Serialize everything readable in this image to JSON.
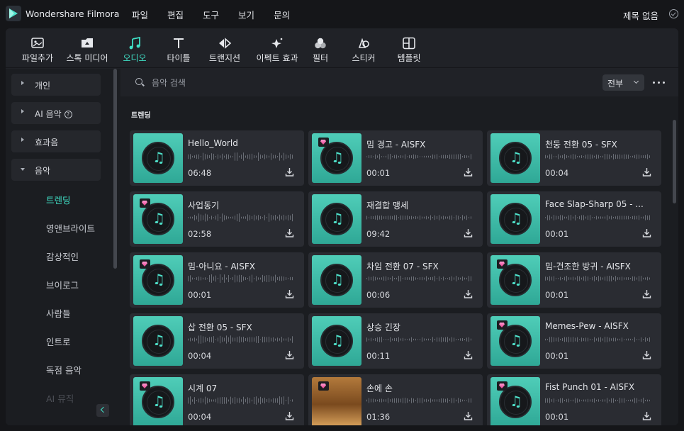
{
  "app": {
    "title": "Wondershare Filmora",
    "doc_title": "제목 없음"
  },
  "menu": [
    "파일",
    "편집",
    "도구",
    "보기",
    "문의"
  ],
  "toolbar": [
    {
      "label": "파일추가",
      "icon": "import-icon",
      "active": false
    },
    {
      "label": "스톡 미디어",
      "icon": "stock-media-icon",
      "active": false
    },
    {
      "label": "오디오",
      "icon": "music-note-icon",
      "active": true
    },
    {
      "label": "타이틀",
      "icon": "text-icon",
      "active": false
    },
    {
      "label": "트랜지션",
      "icon": "transition-icon",
      "active": false
    },
    {
      "label": "이펙트 효과",
      "icon": "effects-icon",
      "active": false
    },
    {
      "label": "필터",
      "icon": "filter-icon",
      "active": false
    },
    {
      "label": "스티커",
      "icon": "sticker-icon",
      "active": false
    },
    {
      "label": "템플릿",
      "icon": "template-icon",
      "active": false
    }
  ],
  "sidebar": {
    "categories": [
      {
        "label": "개인",
        "open": false
      },
      {
        "label": "AI 음악",
        "open": false,
        "help": "?"
      },
      {
        "label": "효과음",
        "open": false
      },
      {
        "label": "음악",
        "open": true
      }
    ],
    "subitems": [
      "트렌딩",
      "영앤브라이트",
      "감상적인",
      "브이로그",
      "사람들",
      "인트로",
      "독점 음악",
      "AI 뮤직"
    ],
    "active_subitem": "트렌딩"
  },
  "search": {
    "placeholder": "음악 검색",
    "value": ""
  },
  "filter": {
    "selected": "전부"
  },
  "section": {
    "title": "트렌딩"
  },
  "tracks": [
    {
      "title": "Hello_World",
      "duration": "06:48",
      "premium": false,
      "photo": false
    },
    {
      "title": "밈 경고 - AISFX",
      "duration": "00:01",
      "premium": true,
      "photo": false
    },
    {
      "title": "천둥 전환 05 - SFX",
      "duration": "00:04",
      "premium": false,
      "photo": false
    },
    {
      "title": "사업동기",
      "duration": "02:58",
      "premium": true,
      "photo": false
    },
    {
      "title": "재결합 맹세",
      "duration": "09:42",
      "premium": false,
      "photo": false
    },
    {
      "title": "Face Slap-Sharp 05 - ...",
      "duration": "00:01",
      "premium": false,
      "photo": false
    },
    {
      "title": "밈-아니요 - AISFX",
      "duration": "00:01",
      "premium": true,
      "photo": false
    },
    {
      "title": "차임 전환 07 - SFX",
      "duration": "00:06",
      "premium": false,
      "photo": false
    },
    {
      "title": "밈-건조한 방귀 - AISFX",
      "duration": "00:01",
      "premium": true,
      "photo": false
    },
    {
      "title": "삽 전환 05 - SFX",
      "duration": "00:04",
      "premium": false,
      "photo": false
    },
    {
      "title": "상승 긴장",
      "duration": "00:11",
      "premium": false,
      "photo": false
    },
    {
      "title": "Memes-Pew - AISFX",
      "duration": "00:01",
      "premium": true,
      "photo": false
    },
    {
      "title": "시계 07",
      "duration": "00:04",
      "premium": true,
      "photo": false
    },
    {
      "title": "손에 손",
      "duration": "01:36",
      "premium": true,
      "photo": true
    },
    {
      "title": "Fist Punch 01 - AISFX",
      "duration": "00:01",
      "premium": true,
      "photo": false
    }
  ],
  "colors": {
    "accent": "#3fe0c6",
    "card": "#2a2c32",
    "panel": "#202227",
    "background": "#151619",
    "premium": "#e8408f"
  }
}
